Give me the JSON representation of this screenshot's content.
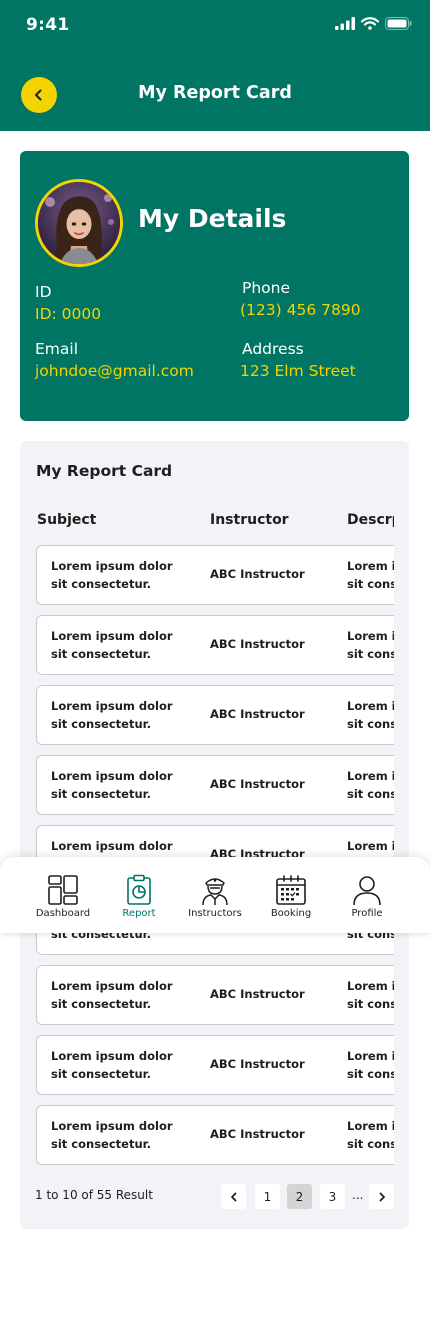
{
  "status_bar": {
    "time": "9:41",
    "icons": [
      "signal-icon",
      "wifi-icon",
      "battery-icon"
    ]
  },
  "header": {
    "title": "My Report Card",
    "back_icon": "chevron-left-icon"
  },
  "details": {
    "title": "My Details",
    "id_label": "ID",
    "id_value": "ID: 0000",
    "phone_label": "Phone",
    "phone_value": "(123) 456 7890",
    "email_label": "Email",
    "email_value": "johndoe@gmail.com",
    "address_label": "Address",
    "address_value": "123 Elm Street"
  },
  "report": {
    "title": "My Report Card",
    "columns": [
      "Subject",
      "Instructor",
      "Descrption"
    ],
    "rows": [
      {
        "subject": "Lorem ipsum dolor sit consectetur.",
        "instructor": "ABC Instructor",
        "description": "Lorem ipsum dolor sit consectetur."
      },
      {
        "subject": "Lorem ipsum dolor sit consectetur.",
        "instructor": "ABC Instructor",
        "description": "Lorem ipsum dolor sit consectetur."
      },
      {
        "subject": "Lorem ipsum dolor sit consectetur.",
        "instructor": "ABC Instructor",
        "description": "Lorem ipsum dolor sit consectetur."
      },
      {
        "subject": "Lorem ipsum dolor sit consectetur.",
        "instructor": "ABC Instructor",
        "description": "Lorem ipsum dolor sit consectetur."
      },
      {
        "subject": "Lorem ipsum dolor sit consectetur.",
        "instructor": "ABC Instructor",
        "description": "Lorem ipsum dolor sit consectetur."
      },
      {
        "subject": "Lorem ipsum dolor sit consectetur.",
        "instructor": "ABC Instructor",
        "description": "Lorem ipsum dolor sit consectetur."
      },
      {
        "subject": "Lorem ipsum dolor sit consectetur.",
        "instructor": "ABC Instructor",
        "description": "Lorem ipsum dolor sit consectetur."
      },
      {
        "subject": "Lorem ipsum dolor sit consectetur.",
        "instructor": "ABC Instructor",
        "description": "Lorem ipsum dolor sit consectetur."
      },
      {
        "subject": "Lorem ipsum dolor sit consectetur.",
        "instructor": "ABC Instructor",
        "description": "Lorem ipsum dolor sit consectetur."
      }
    ],
    "pagination": {
      "summary": "1 to 10 of 55 Result",
      "pages": [
        "1",
        "2",
        "3"
      ],
      "current_page": "2",
      "ellipsis": "...",
      "prev_icon": "chevron-left-icon",
      "next_icon": "chevron-right-icon"
    }
  },
  "bottom_nav": {
    "items": [
      {
        "label": "Dashboard",
        "icon": "dashboard-grid-icon"
      },
      {
        "label": "Report",
        "icon": "report-clipboard-icon",
        "active": true
      },
      {
        "label": "Instructors",
        "icon": "instructor-icon"
      },
      {
        "label": "Booking",
        "icon": "calendar-icon"
      },
      {
        "label": "Profile",
        "icon": "profile-person-icon"
      }
    ]
  },
  "colors": {
    "primary": "#007563",
    "accent": "#F3D300",
    "card_bg": "#F2F3F7",
    "text": "#1E1E1E"
  }
}
